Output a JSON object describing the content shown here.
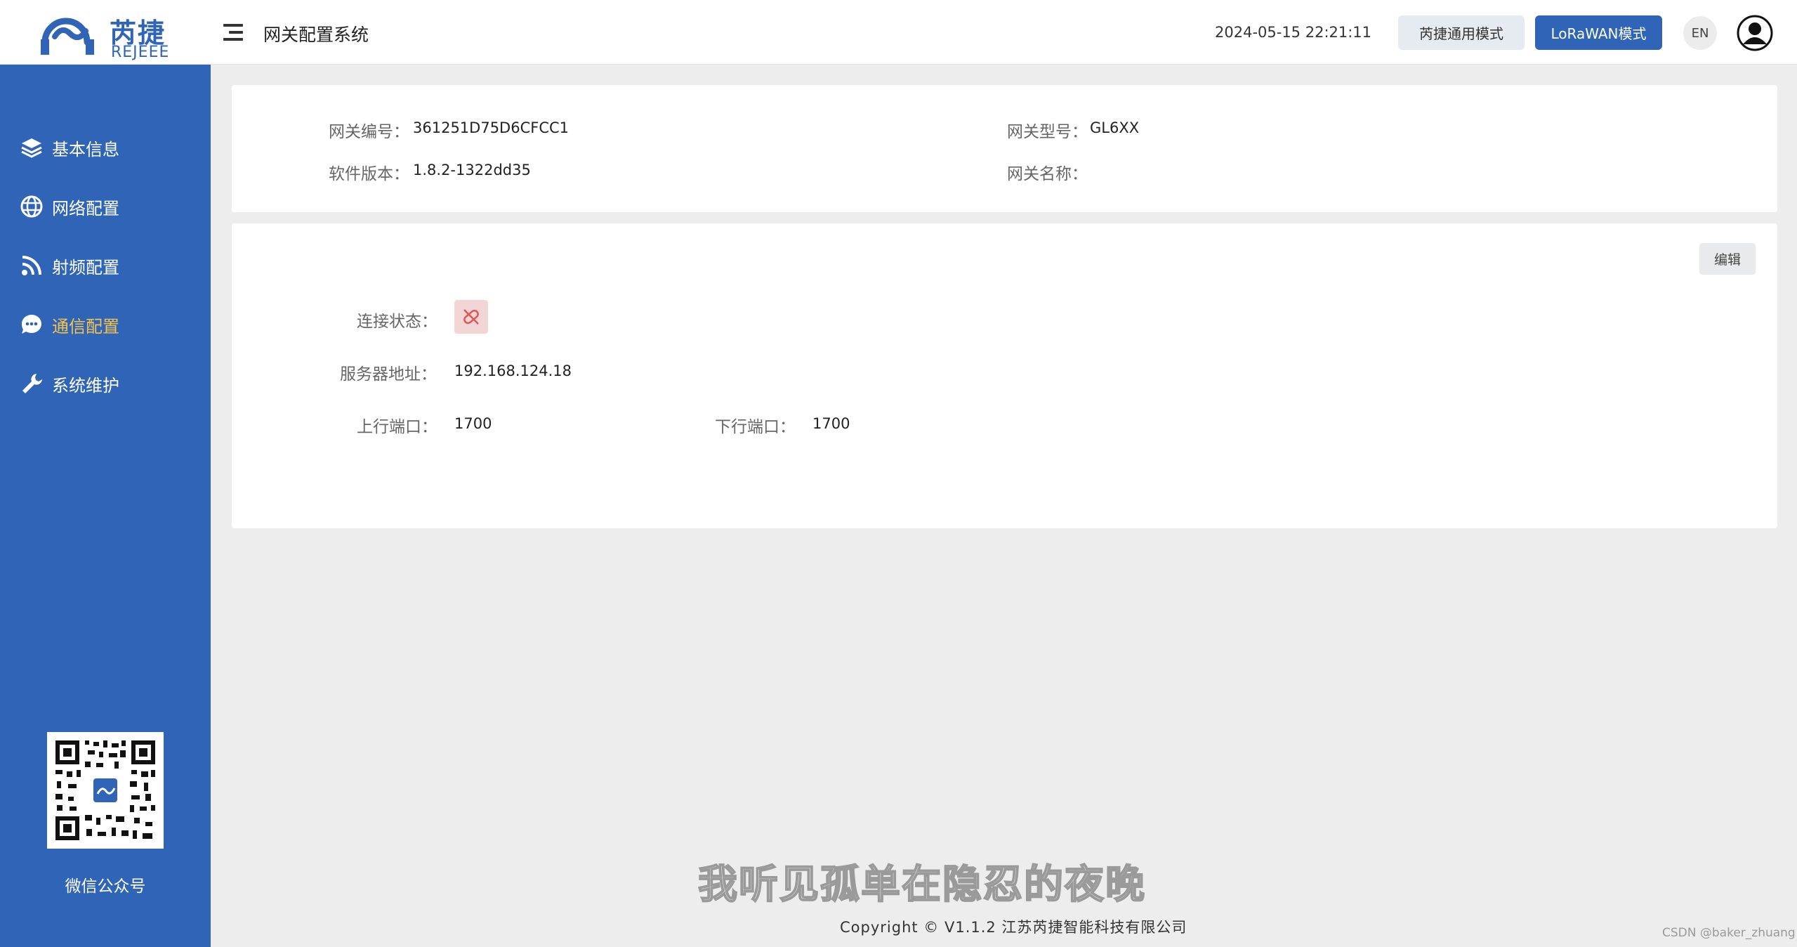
{
  "brand": {
    "name_cn": "芮捷",
    "name_en": "REJEEE",
    "accent": "#2f64b7"
  },
  "header": {
    "title": "网关配置系统",
    "datetime": "2024-05-15 22:21:11",
    "mode_general": "芮捷通用模式",
    "mode_lorawan": "LoRaWAN模式",
    "language": "EN",
    "icons": [
      "menu-icon",
      "user-icon"
    ]
  },
  "sidebar": {
    "items": [
      {
        "label": "基本信息",
        "icon": "layers-icon"
      },
      {
        "label": "网络配置",
        "icon": "globe-icon"
      },
      {
        "label": "射频配置",
        "icon": "rss-icon"
      },
      {
        "label": "通信配置",
        "icon": "chat-icon",
        "active": true
      },
      {
        "label": "系统维护",
        "icon": "wrench-icon"
      }
    ],
    "active_color": "#f6c34a",
    "qr_label": "微信公众号"
  },
  "info": {
    "gateway_id_label": "网关编号：",
    "gateway_id": "361251D75D6CFCC1",
    "gateway_model_label": "网关型号：",
    "gateway_model": "GL6XX",
    "software_version_label": "软件版本：",
    "software_version": "1.8.2-1322dd35",
    "gateway_name_label": "网关名称：",
    "gateway_name": ""
  },
  "comm": {
    "edit_label": "编辑",
    "connection_status_label": "连接状态：",
    "connection_status_icon": "disconnected-icon",
    "server_address_label": "服务器地址：",
    "server_address": "192.168.124.18",
    "uplink_port_label": "上行端口：",
    "uplink_port": "1700",
    "downlink_port_label": "下行端口：",
    "downlink_port": "1700"
  },
  "footer": {
    "subtitle_overlay": "我听见孤单在隐忍的夜晚",
    "copyright": "Copyright © V1.1.2 江苏芮捷智能科技有限公司",
    "watermark": "CSDN @baker_zhuang"
  }
}
